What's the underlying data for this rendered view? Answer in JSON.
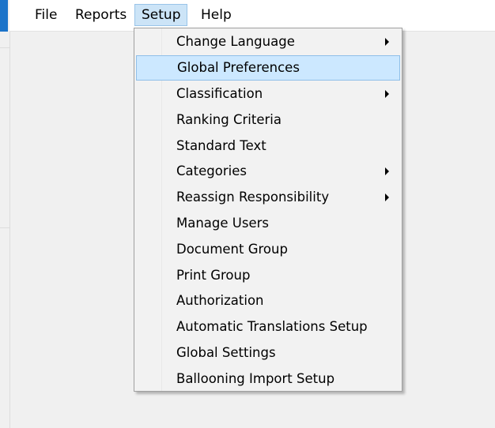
{
  "menubar": {
    "items": [
      {
        "label": "File"
      },
      {
        "label": "Reports"
      },
      {
        "label": "Setup"
      },
      {
        "label": "Help"
      }
    ]
  },
  "setup_menu": {
    "items": [
      {
        "label": "Change Language",
        "submenu": true
      },
      {
        "label": "Global Preferences",
        "highlighted": true
      },
      {
        "label": "Classification",
        "submenu": true
      },
      {
        "label": "Ranking Criteria"
      },
      {
        "label": "Standard Text"
      },
      {
        "label": "Categories",
        "submenu": true
      },
      {
        "label": "Reassign Responsibility",
        "submenu": true
      },
      {
        "label": "Manage Users"
      },
      {
        "label": "Document Group"
      },
      {
        "label": "Print Group"
      },
      {
        "label": "Authorization"
      },
      {
        "label": "Automatic Translations Setup"
      },
      {
        "label": "Global Settings"
      },
      {
        "label": "Ballooning Import Setup"
      }
    ]
  },
  "colors": {
    "accent": "#1b73c9",
    "highlight": "#cce8ff",
    "highlight_border": "#8fbfe8"
  }
}
